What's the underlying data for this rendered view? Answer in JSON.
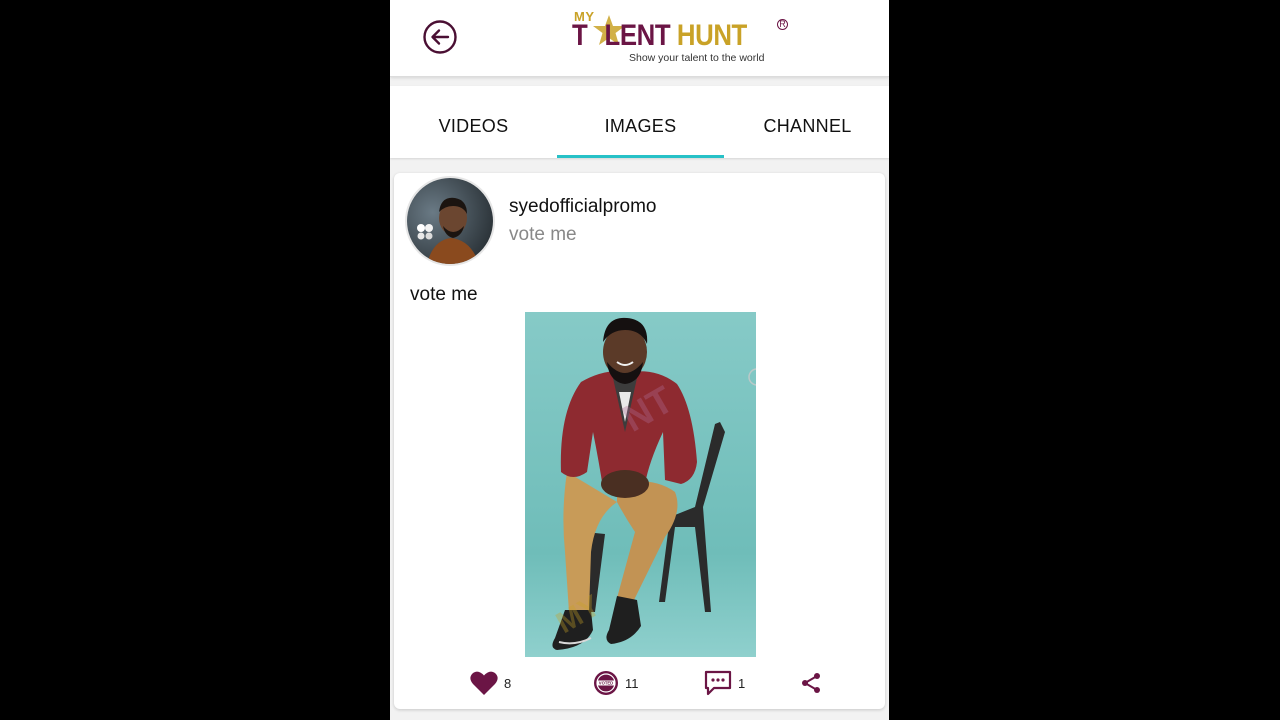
{
  "header": {
    "logo_my": "MY",
    "logo_part1": "T",
    "logo_part2": "LENT ",
    "logo_part3": "HUNT",
    "logo_tagline": "Show your talent to the world",
    "brand_color": "#6b1545",
    "accent_gold": "#c9a227"
  },
  "tabs": [
    {
      "label": "VIDEOS"
    },
    {
      "label": "IMAGES"
    },
    {
      "label": "CHANNEL"
    }
  ],
  "active_tab": "IMAGES",
  "tab_indicator_color": "#27c1c7",
  "post": {
    "username": "syedofficialpromo",
    "subtitle": "vote me",
    "caption": "vote me",
    "likes": "8",
    "votes": "11",
    "comments": "1",
    "vote_badge_text": "VOTED"
  },
  "icons": {
    "back": "back-arrow-icon",
    "like": "heart-icon",
    "vote": "voted-badge-icon",
    "comment": "comment-icon",
    "share": "share-icon"
  }
}
